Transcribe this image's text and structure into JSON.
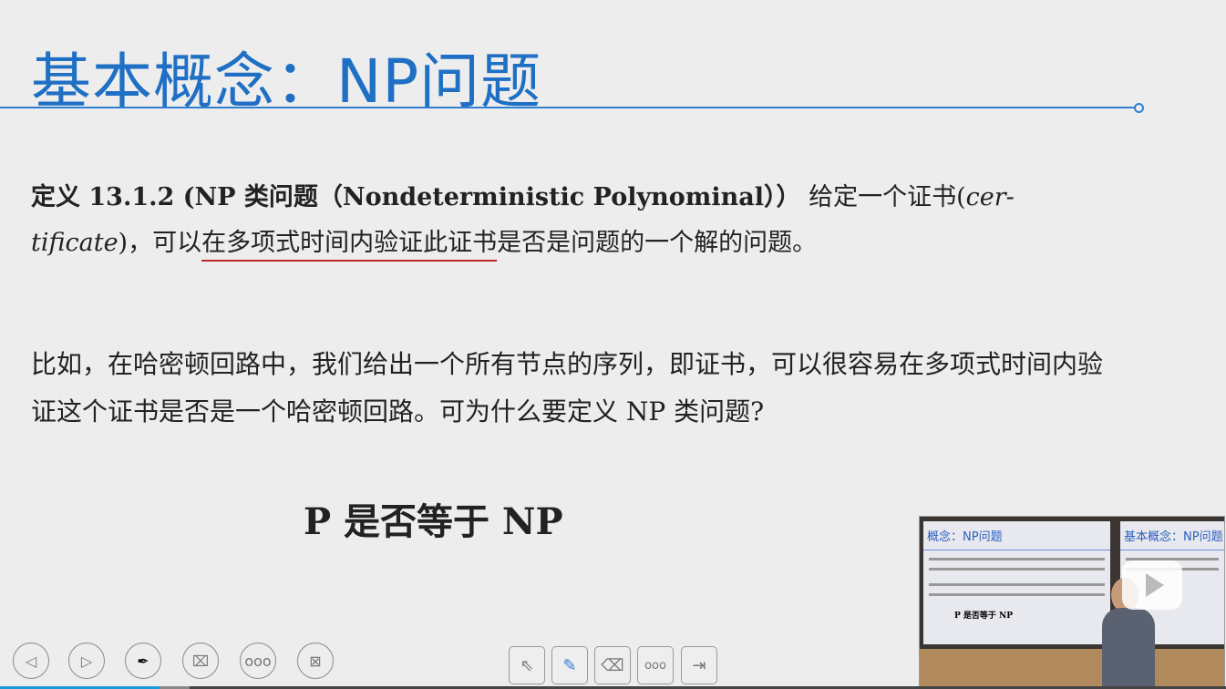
{
  "slide": {
    "title": "基本概念：NP问题",
    "definition": {
      "label": "定义 13.1.2 (NP 类问题（Nondeterministic Polynominal））",
      "text_a": "给定一个证书(",
      "cert_word": "cer-tificate",
      "text_b": ")，可以",
      "underlined": "在多项式时间内验证此证书",
      "text_c": "是否是问题的一个解的问题。"
    },
    "paragraph": "比如，在哈密顿回路中，我们给出一个所有节点的序列，即证书，可以很容易在多项式时间内验证这个证书是否是一个哈密顿回路。可为什么要定义 NP 类问题?",
    "question": "P 是否等于 NP",
    "accent": "#1f6fc5",
    "underline_color": "#c0262c"
  },
  "controls": {
    "left": [
      "prev-icon",
      "next-icon",
      "pen-icon",
      "screen-select-icon",
      "more-icon",
      "exit-presentation-icon"
    ],
    "right": [
      "pointer-icon",
      "pencil-icon",
      "eraser-icon",
      "more-icon",
      "exit-icon"
    ],
    "more_label": "ooo"
  },
  "camera": {
    "left_title": "概念：NP问题",
    "right_title": "基本概念：NP问题",
    "question": "P 是否等于 NP",
    "overlay_icon": "play-logo-icon"
  },
  "progress": {
    "played_fraction": 0.13,
    "buffered_fraction": 0.155,
    "color": "#1a9ad8"
  }
}
